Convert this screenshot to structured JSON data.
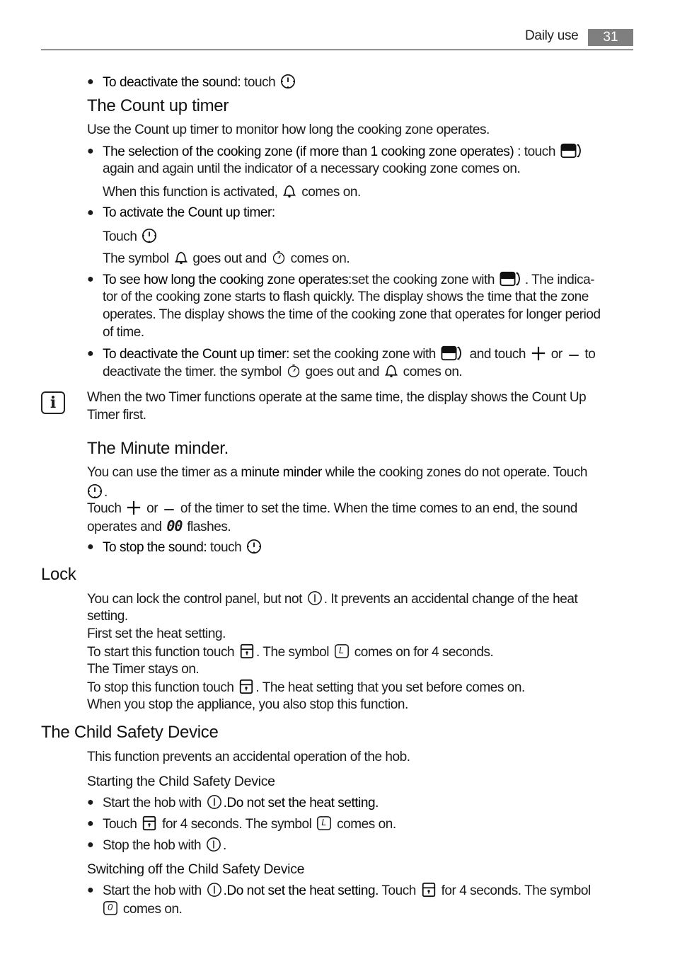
{
  "header": {
    "section": "Daily use",
    "page_number": "31"
  },
  "count_up": {
    "deactivate_sound_label": "To deactivate the sound:",
    "deactivate_sound_text": " touch",
    "title": "The Count up timer",
    "intro": "Use the Count up timer to monitor how long the cooking zone operates.",
    "b1_label": "The selection of the cooking zone (if more than 1 cooking zone operates) :",
    "b1_text": " touch",
    "b1_line2": "again and again until the indicator of a necessary cooking zone comes on.",
    "b1_line3a": "When this function is activated,",
    "b1_line3b": "comes on.",
    "b2_label": "To activate the Count up timer:",
    "b2_touch": "Touch",
    "b2_sym_a": "The symbol",
    "b2_sym_b": "goes out and",
    "b2_sym_c": "comes on.",
    "b3_label": "To see how long the cooking zone operates:",
    "b3_text1": "set the cooking zone with",
    "b3_text2": ". The indica-",
    "b3_line2": "tor of the cooking zone starts to flash quickly. The display shows the time that the zone",
    "b3_line3": "operates. The display shows the time of the cooking zone that operates for longer period",
    "b3_line4": "of time.",
    "b4_label": "To deactivate the Count up timer:",
    "b4_text1": " set the cooking zone with",
    "b4_text2": "and touch",
    "b4_or": "or",
    "b4_to": "to",
    "b4_line2a": "deactivate the timer. the symbol",
    "b4_line2b": "goes out and",
    "b4_line2c": "comes on."
  },
  "info": {
    "line1": "When the two Timer functions operate at the same time, the display shows the Count Up",
    "line2": "Timer first."
  },
  "minute_minder": {
    "title": "The Minute minder.",
    "p1a": "You can use the timer as a ",
    "p1_bold": "minute minder",
    "p1b": " while the cooking zones do not operate. Touch",
    "p1_end": ".",
    "p2a": "Touch",
    "p2_or": "or",
    "p2b": "of the timer to set the time. When the time comes to an end, the sound",
    "p3a": "operates and",
    "p3b": "flashes.",
    "stop_label": "To stop the sound:",
    "stop_text": " touch"
  },
  "lock": {
    "title": "Lock",
    "l1a": "You can lock the control panel, but not",
    "l1b": ". It prevents an accidental change of the heat",
    "l2": "setting.",
    "l3": "First set the heat setting.",
    "l4a": "To start this function touch",
    "l4b": ". The symbol",
    "l4c": "comes on for 4 seconds.",
    "l5": "The Timer stays on.",
    "l6a": "To stop this function touch",
    "l6b": ". The heat setting that you set before comes on.",
    "l7": "When you stop the appliance, you also stop this function."
  },
  "child_safety": {
    "title": "The Child Safety Device",
    "intro": "This function prevents an accidental operation of the hob.",
    "start_title": "Starting the Child Safety Device",
    "s1a": "Start the hob with",
    "s1b": ".Do not set the heat setting.",
    "s2a": "Touch",
    "s2b": "for 4 seconds. The symbol",
    "s2c": "comes on.",
    "s3a": "Stop the hob with",
    "s3b": ".",
    "off_title": "Switching off the Child Safety Device",
    "o1a": "Start the hob with",
    "o1b": ".Do not set the heat setting.",
    "o1c": " Touch",
    "o1d": "for 4 seconds. The symbol",
    "o2": "comes on."
  },
  "symbols": {
    "lock_display": "L",
    "zero_display": "0",
    "double_zero_display": "00"
  }
}
